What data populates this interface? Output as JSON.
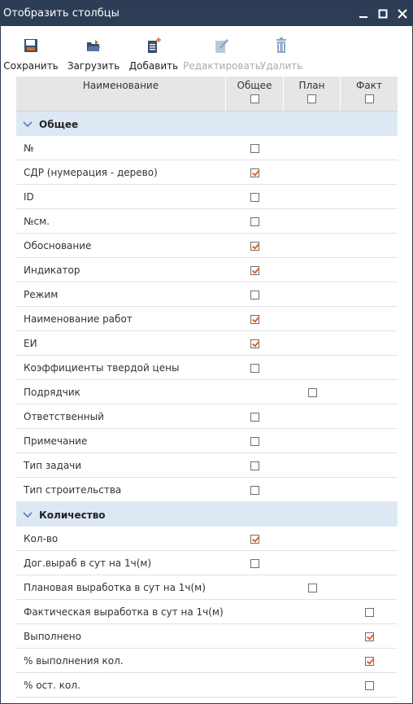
{
  "window": {
    "title": "Отобразить столбцы"
  },
  "toolbar": {
    "save": "Сохранить",
    "load": "Загрузить",
    "add": "Добавить",
    "edit": "Редактировать",
    "delete": "Удалить"
  },
  "columns": {
    "name": "Наименование",
    "general": "Общее",
    "plan": "План",
    "fact": "Факт"
  },
  "header_checks": {
    "general": false,
    "plan": false,
    "fact": false
  },
  "groups": [
    {
      "label": "Общее",
      "rows": [
        {
          "name": "№",
          "general": false
        },
        {
          "name": "СДР (нумерация - дерево)",
          "general": true
        },
        {
          "name": "ID",
          "general": false
        },
        {
          "name": "№см.",
          "general": false
        },
        {
          "name": "Обоснование",
          "general": true
        },
        {
          "name": "Индикатор",
          "general": true
        },
        {
          "name": "Режим",
          "general": false
        },
        {
          "name": "Наименование работ",
          "general": true
        },
        {
          "name": "ЕИ",
          "general": true
        },
        {
          "name": "Коэффициенты твердой цены",
          "general": false
        },
        {
          "name": "Подрядчик",
          "plan": false
        },
        {
          "name": "Ответственный",
          "general": false
        },
        {
          "name": "Примечание",
          "general": false
        },
        {
          "name": "Тип задачи",
          "general": false
        },
        {
          "name": "Тип строительства",
          "general": false
        }
      ]
    },
    {
      "label": "Количество",
      "rows": [
        {
          "name": "Кол-во",
          "general": true
        },
        {
          "name": "Дог.выраб в сут на 1ч(м)",
          "general": false
        },
        {
          "name": "Плановая выработка в сут на 1ч(м)",
          "plan": false
        },
        {
          "name": "Фактическая выработка в сут на 1ч(м)",
          "fact": false
        },
        {
          "name": "Выполнено",
          "fact": true
        },
        {
          "name": "% выполнения кол.",
          "fact": true
        },
        {
          "name": "% ост. кол.",
          "fact": false
        }
      ]
    }
  ]
}
